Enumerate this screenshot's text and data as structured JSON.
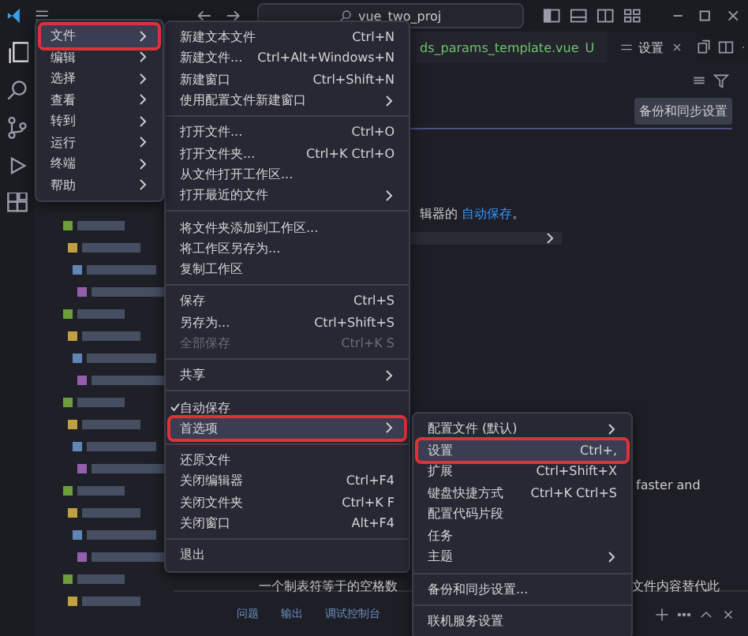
{
  "title_bar": {
    "search": "vue_two_proj"
  },
  "tabs": [
    {
      "label": "ds_params_template.vue",
      "badge": "U",
      "selected": false,
      "modified": true
    },
    {
      "label": "设置",
      "selected": true
    }
  ],
  "settings": {
    "button": "备份和同步设置",
    "description_tail": "辑器的",
    "link": "自动保存",
    "link_end": "。",
    "text_1": "faster and",
    "text_2": "一个制表符等于的空格数",
    "text_3": "文件内容替代此"
  },
  "panel": {
    "tabs": [
      {
        "label": "问题",
        "selected": false
      },
      {
        "label": "输出",
        "selected": false
      },
      {
        "label": "调试控制台",
        "selected": false
      }
    ]
  },
  "main_menu": [
    {
      "label": "文件",
      "selected": true
    },
    {
      "label": "编辑",
      "selected": false
    },
    {
      "label": "选择",
      "selected": false
    },
    {
      "label": "查看",
      "selected": false
    },
    {
      "label": "转到",
      "selected": false
    },
    {
      "label": "运行",
      "selected": false
    },
    {
      "label": "终端",
      "selected": false
    },
    {
      "label": "帮助",
      "selected": false
    }
  ],
  "file_menu": [
    {
      "kind": "item",
      "label": "新建文本文件",
      "shortcut": "Ctrl+N"
    },
    {
      "kind": "item",
      "label": "新建文件...",
      "shortcut": "Ctrl+Alt+Windows+N"
    },
    {
      "kind": "item",
      "label": "新建窗口",
      "shortcut": "Ctrl+Shift+N"
    },
    {
      "kind": "submenu",
      "label": "使用配置文件新建窗口",
      "selected": false
    },
    {
      "kind": "separator"
    },
    {
      "kind": "item",
      "label": "打开文件...",
      "shortcut": "Ctrl+O"
    },
    {
      "kind": "item",
      "label": "打开文件夹...",
      "shortcut": "Ctrl+K Ctrl+O"
    },
    {
      "kind": "item",
      "label": "从文件打开工作区..."
    },
    {
      "kind": "submenu",
      "label": "打开最近的文件",
      "selected": false
    },
    {
      "kind": "separator"
    },
    {
      "kind": "item",
      "label": "将文件夹添加到工作区..."
    },
    {
      "kind": "item",
      "label": "将工作区另存为..."
    },
    {
      "kind": "item",
      "label": "复制工作区"
    },
    {
      "kind": "separator"
    },
    {
      "kind": "item",
      "label": "保存",
      "shortcut": "Ctrl+S"
    },
    {
      "kind": "item",
      "label": "另存为...",
      "shortcut": "Ctrl+Shift+S"
    },
    {
      "kind": "item",
      "label": "全部保存",
      "shortcut": "Ctrl+K S",
      "disabled": true
    },
    {
      "kind": "separator"
    },
    {
      "kind": "submenu",
      "label": "共享",
      "selected": false
    },
    {
      "kind": "separator"
    },
    {
      "kind": "check",
      "label": "自动保存",
      "checked": true
    },
    {
      "kind": "submenu",
      "label": "首选项",
      "selected": true
    },
    {
      "kind": "separator"
    },
    {
      "kind": "item",
      "label": "还原文件"
    },
    {
      "kind": "item",
      "label": "关闭编辑器",
      "shortcut": "Ctrl+F4"
    },
    {
      "kind": "item",
      "label": "关闭文件夹",
      "shortcut": "Ctrl+K F"
    },
    {
      "kind": "item",
      "label": "关闭窗口",
      "shortcut": "Alt+F4"
    },
    {
      "kind": "separator"
    },
    {
      "kind": "item",
      "label": "退出"
    }
  ],
  "preferences_menu": [
    {
      "kind": "submenu",
      "label": "配置文件 (默认)",
      "selected": false
    },
    {
      "kind": "item",
      "label": "设置",
      "shortcut": "Ctrl+,",
      "selected": true
    },
    {
      "kind": "item",
      "label": "扩展",
      "shortcut": "Ctrl+Shift+X",
      "selected": false
    },
    {
      "kind": "item",
      "label": "键盘快捷方式",
      "shortcut": "Ctrl+K Ctrl+S",
      "selected": false
    },
    {
      "kind": "item",
      "label": "配置代码片段",
      "selected": false
    },
    {
      "kind": "item",
      "label": "任务",
      "selected": false
    },
    {
      "kind": "submenu",
      "label": "主题",
      "selected": false
    },
    {
      "kind": "separator"
    },
    {
      "kind": "item",
      "label": "备份和同步设置...",
      "selected": false
    },
    {
      "kind": "separator"
    },
    {
      "kind": "item",
      "label": "联机服务设置",
      "selected": false
    }
  ]
}
